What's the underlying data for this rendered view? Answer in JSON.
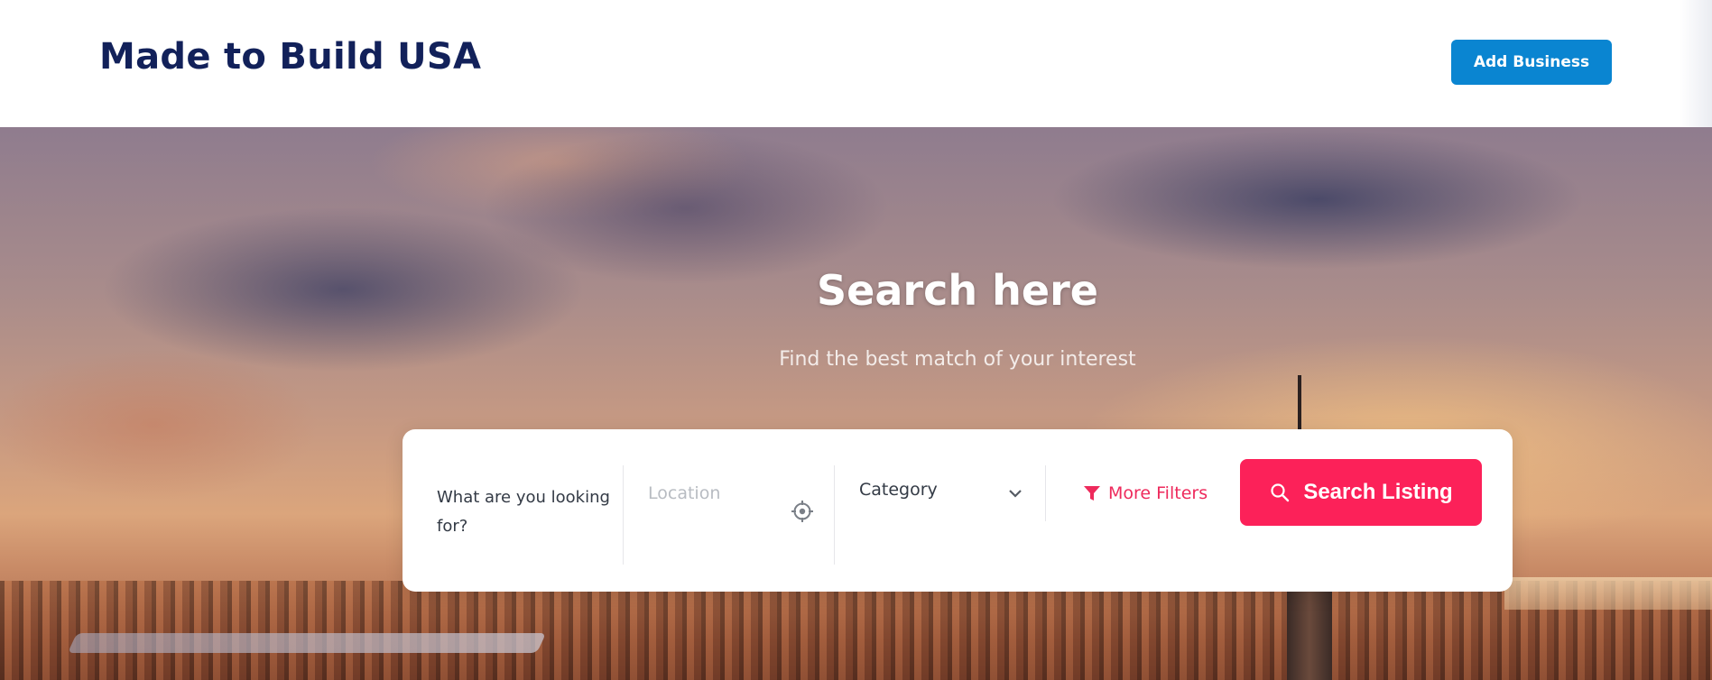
{
  "header": {
    "logo": "Made to Build USA",
    "add_business_label": "Add Business"
  },
  "hero": {
    "title": "Search here",
    "subtitle": "Find the best match of your interest"
  },
  "search": {
    "what_label": "What are you looking for?",
    "location_placeholder": "Location",
    "category_label": "Category",
    "more_filters_label": "More Filters",
    "search_button_label": "Search Listing"
  },
  "colors": {
    "brand_navy": "#12215a",
    "add_business_blue": "#0a85d1",
    "accent_pink": "#fc2159"
  },
  "icons": {
    "location": "crosshair-icon",
    "category": "chevron-down-icon",
    "filters": "funnel-icon",
    "search": "search-icon"
  }
}
